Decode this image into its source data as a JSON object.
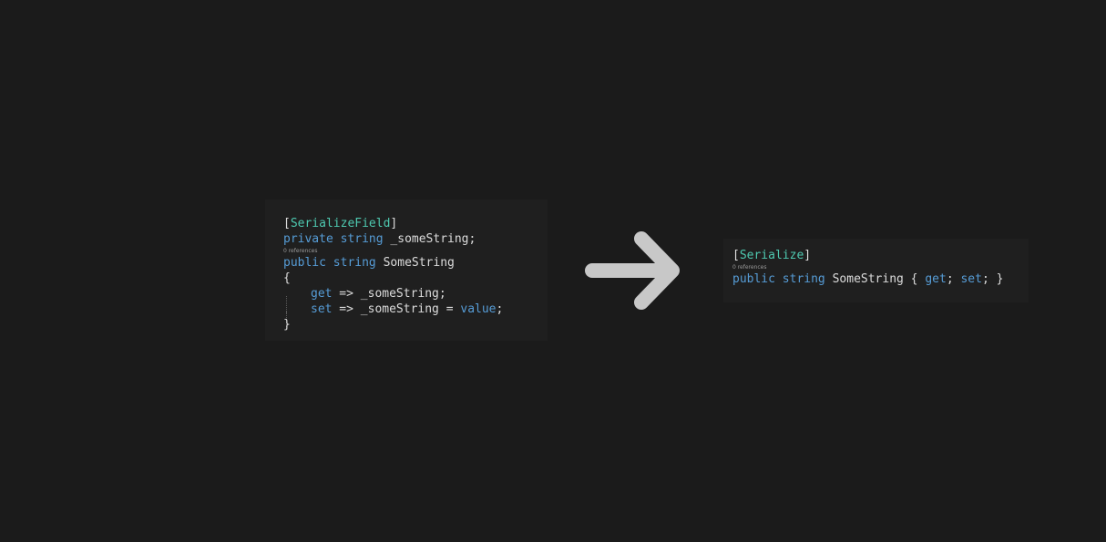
{
  "left_snippet": {
    "attribute_open": "[",
    "attribute_name": "SerializeField",
    "attribute_close": "]",
    "line2": {
      "kw1": "private",
      "kw2": "string",
      "rest": " _someString;"
    },
    "codelens": "0 references",
    "line3": {
      "kw1": "public",
      "kw2": "string",
      "rest": " SomeString"
    },
    "open_brace": "{",
    "getter": {
      "kw": "get",
      "rest": " => _someString;"
    },
    "setter": {
      "kw": "set",
      "rest": " => _someString = ",
      "value_kw": "value",
      "end": ";"
    },
    "close_brace": "}"
  },
  "right_snippet": {
    "attribute_open": "[",
    "attribute_name": "Serialize",
    "attribute_close": "]",
    "codelens": "0 references",
    "decl": {
      "kw1": "public",
      "kw2": "string",
      "name": " SomeString { ",
      "get": "get",
      "sep": "; ",
      "set": "set",
      "end": "; }"
    }
  },
  "colors": {
    "background": "#1b1b1b",
    "panel": "#1f1f1f",
    "keyword": "#569cd6",
    "type": "#4ec9b0",
    "text": "#dcdcdc",
    "arrow": "#c8c8c8"
  },
  "icons": {
    "arrow": "arrow-right-icon"
  }
}
